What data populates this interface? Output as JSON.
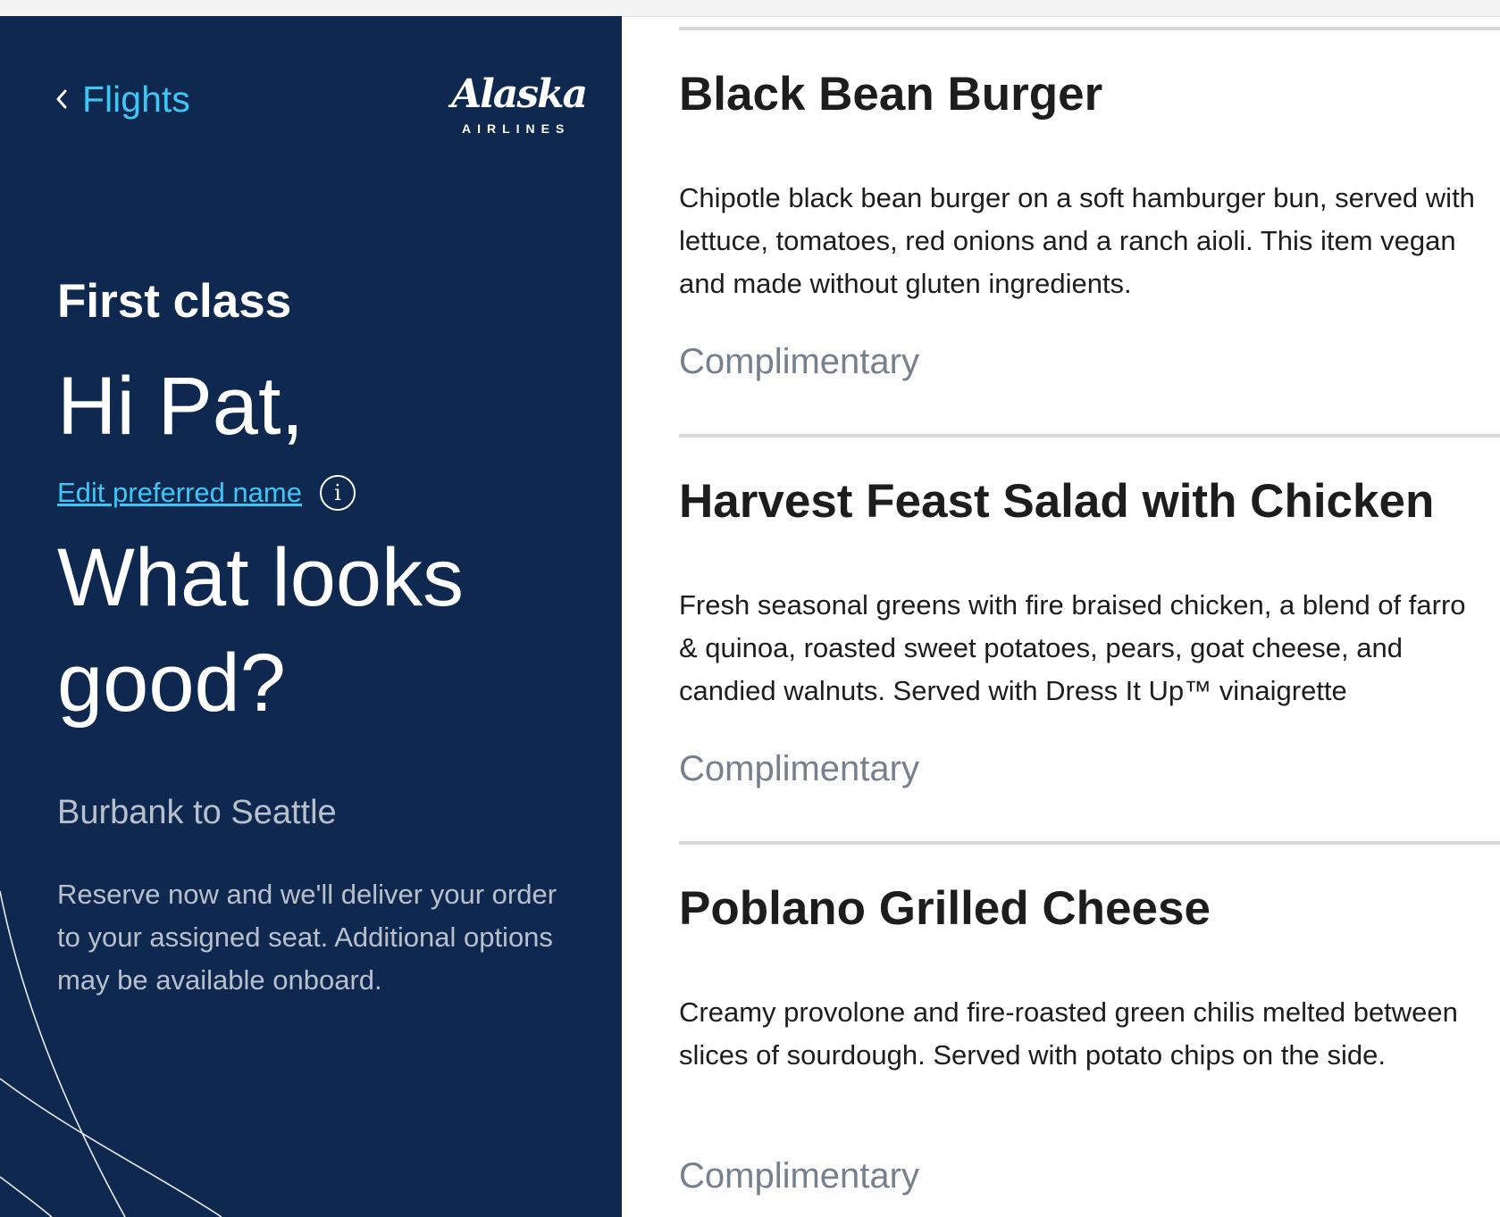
{
  "header": {
    "back_label": "Flights",
    "logo_name": "Alaska",
    "logo_sub": "AIRLINES"
  },
  "hero": {
    "cabin": "First class",
    "greeting": "Hi Pat,",
    "edit_name_label": "Edit preferred name",
    "question": "What looks good?",
    "route": "Burbank to Seattle",
    "note": "Reserve now and we'll deliver your order to your assigned seat. Additional options may be available onboard."
  },
  "menu": {
    "items": [
      {
        "title": "Black Bean Burger",
        "description": "Chipotle black bean burger on a soft hamburger bun, served with lettuce, tomatoes, red onions and a ranch aioli. This item vegan and made without gluten ingredients.",
        "price": "Complimentary"
      },
      {
        "title": "Harvest Feast Salad with Chicken",
        "description": "Fresh seasonal greens with fire braised chicken, a blend of farro & quinoa, roasted sweet potatoes, pears, goat cheese, and candied walnuts. Served with Dress It Up™ vinaigrette",
        "price": "Complimentary"
      },
      {
        "title": "Poblano Grilled Cheese",
        "description": "Creamy provolone and fire-roasted green chilis melted between slices of sourdough. Served with potato chips on the side.",
        "price": "Complimentary"
      }
    ]
  },
  "colors": {
    "panel_bg": "#0f284f",
    "accent_link": "#40c6f5",
    "muted_text": "#b8c0cc",
    "price_text": "#77808e"
  },
  "icons": {
    "back": "chevron-left-icon",
    "info": "info-icon"
  }
}
